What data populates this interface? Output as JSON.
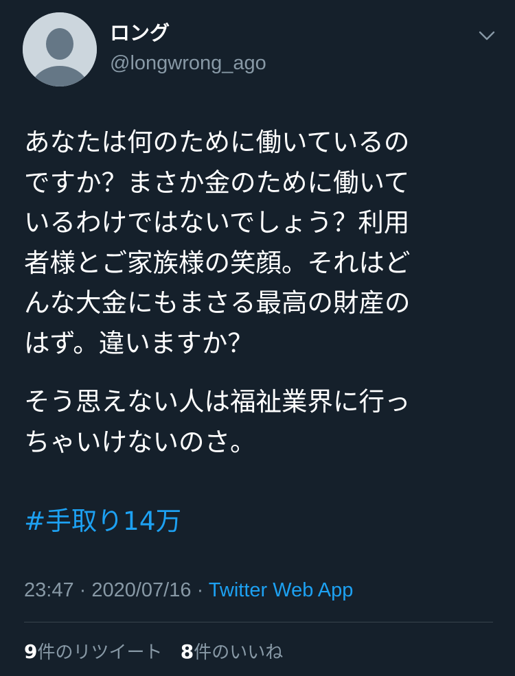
{
  "author": {
    "display_name": "ロング",
    "handle": "@longwrong_ago",
    "avatar_icon": "default-avatar-person-icon"
  },
  "menu_icon": "chevron-down-icon",
  "tweet": {
    "paragraph1_lines": [
      "あなたは何のために働いているの",
      "ですか？まさか金のために働いて",
      "いるわけではないでしょう？利用",
      "者様とご家族様の笑顔。それはど",
      "んな大金にもまさる最高の財産の",
      "はず。違いますか？"
    ],
    "paragraph2_lines": [
      "そう思えない人は福祉業界に行っ",
      "ちゃいけないのさ。"
    ],
    "hashtag": "#手取り14万"
  },
  "meta": {
    "time": "23:47",
    "separator": " · ",
    "date": "2020/07/16",
    "source": "Twitter Web App"
  },
  "stats": {
    "retweets_count": "9",
    "retweets_label": "件のリツイート",
    "likes_count": "8",
    "likes_label": "件のいいね"
  },
  "colors": {
    "background": "#15202b",
    "text": "#ffffff",
    "secondary_text": "#8899a6",
    "accent": "#1da1f2",
    "divider": "#38444d",
    "avatar_bg": "#ccd6dd",
    "avatar_figure": "#657786"
  }
}
